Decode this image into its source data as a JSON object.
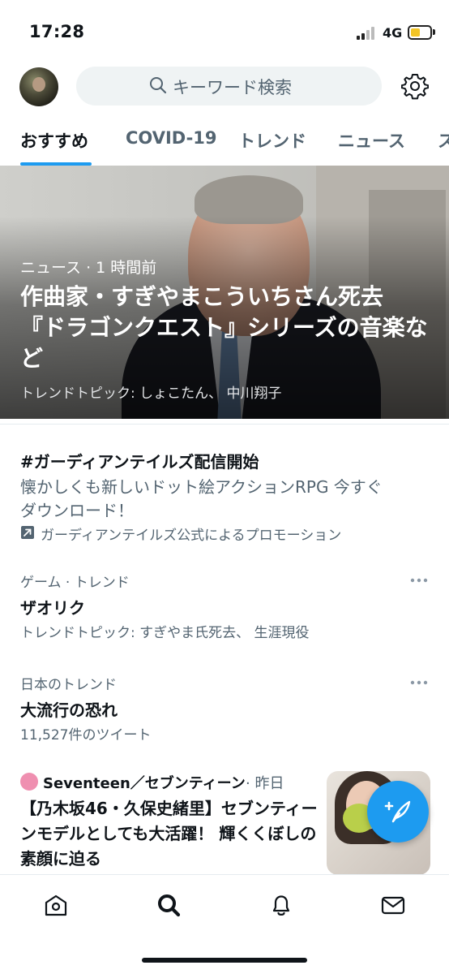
{
  "status_bar": {
    "time": "17:28",
    "network": "4G"
  },
  "search": {
    "placeholder": "キーワード検索"
  },
  "tabs": [
    {
      "label": "おすすめ",
      "active": true
    },
    {
      "label": "COVID-19"
    },
    {
      "label": "トレンド"
    },
    {
      "label": "ニュース"
    },
    {
      "label": "ス"
    }
  ],
  "hero": {
    "meta": "ニュース · 1 時間前",
    "title": "作曲家・すぎやまこういちさん死去 『ドラゴンクエスト』シリーズの音楽など",
    "topic": "トレンドトピック: しょこたん、 中川翔子"
  },
  "promo": {
    "title": "#ガーディアンテイルズ配信開始",
    "description": "懐かしくも新しいドット絵アクションRPG 今すぐダウンロード！",
    "promoted_by": "ガーディアンテイルズ公式によるプロモーション"
  },
  "trends": [
    {
      "context": "ゲーム · トレンド",
      "name": "ザオリク",
      "detail": "トレンドトピック: すぎやま氏死去、 生涯現役"
    },
    {
      "context": "日本のトレンド",
      "name": "大流行の恐れ",
      "detail": "11,527件のツイート"
    }
  ],
  "news": {
    "source": "Seventeen／セブンティーン",
    "time": "· 昨日",
    "title": "【乃木坂46・久保史緒里】セブンティーンモデルとしても大活躍！ 輝くくぼしの素顔に迫る"
  },
  "colors": {
    "accent": "#1d9bf0",
    "text": "#0f1419",
    "secondary": "#536471"
  },
  "icons": [
    "search-icon",
    "settings-icon",
    "external-link-icon",
    "more-icon",
    "compose-icon",
    "home-icon",
    "explore-icon",
    "notifications-icon",
    "messages-icon"
  ]
}
